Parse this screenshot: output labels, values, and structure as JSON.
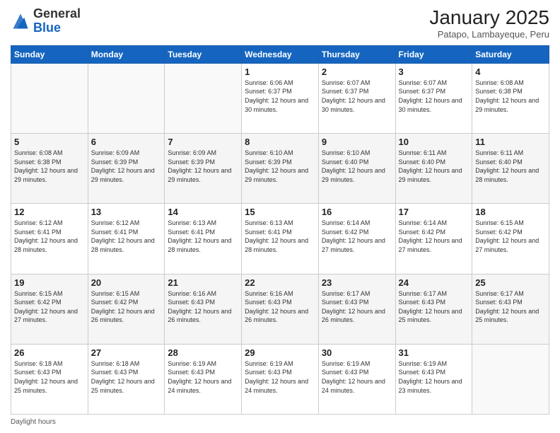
{
  "header": {
    "logo_general": "General",
    "logo_blue": "Blue",
    "month_year": "January 2025",
    "location": "Patapo, Lambayeque, Peru"
  },
  "days_of_week": [
    "Sunday",
    "Monday",
    "Tuesday",
    "Wednesday",
    "Thursday",
    "Friday",
    "Saturday"
  ],
  "footer": {
    "label": "Daylight hours"
  },
  "weeks": [
    [
      {
        "day": "",
        "sunrise": "",
        "sunset": "",
        "daylight": ""
      },
      {
        "day": "",
        "sunrise": "",
        "sunset": "",
        "daylight": ""
      },
      {
        "day": "",
        "sunrise": "",
        "sunset": "",
        "daylight": ""
      },
      {
        "day": "1",
        "sunrise": "Sunrise: 6:06 AM",
        "sunset": "Sunset: 6:37 PM",
        "daylight": "Daylight: 12 hours and 30 minutes."
      },
      {
        "day": "2",
        "sunrise": "Sunrise: 6:07 AM",
        "sunset": "Sunset: 6:37 PM",
        "daylight": "Daylight: 12 hours and 30 minutes."
      },
      {
        "day": "3",
        "sunrise": "Sunrise: 6:07 AM",
        "sunset": "Sunset: 6:37 PM",
        "daylight": "Daylight: 12 hours and 30 minutes."
      },
      {
        "day": "4",
        "sunrise": "Sunrise: 6:08 AM",
        "sunset": "Sunset: 6:38 PM",
        "daylight": "Daylight: 12 hours and 29 minutes."
      }
    ],
    [
      {
        "day": "5",
        "sunrise": "Sunrise: 6:08 AM",
        "sunset": "Sunset: 6:38 PM",
        "daylight": "Daylight: 12 hours and 29 minutes."
      },
      {
        "day": "6",
        "sunrise": "Sunrise: 6:09 AM",
        "sunset": "Sunset: 6:39 PM",
        "daylight": "Daylight: 12 hours and 29 minutes."
      },
      {
        "day": "7",
        "sunrise": "Sunrise: 6:09 AM",
        "sunset": "Sunset: 6:39 PM",
        "daylight": "Daylight: 12 hours and 29 minutes."
      },
      {
        "day": "8",
        "sunrise": "Sunrise: 6:10 AM",
        "sunset": "Sunset: 6:39 PM",
        "daylight": "Daylight: 12 hours and 29 minutes."
      },
      {
        "day": "9",
        "sunrise": "Sunrise: 6:10 AM",
        "sunset": "Sunset: 6:40 PM",
        "daylight": "Daylight: 12 hours and 29 minutes."
      },
      {
        "day": "10",
        "sunrise": "Sunrise: 6:11 AM",
        "sunset": "Sunset: 6:40 PM",
        "daylight": "Daylight: 12 hours and 29 minutes."
      },
      {
        "day": "11",
        "sunrise": "Sunrise: 6:11 AM",
        "sunset": "Sunset: 6:40 PM",
        "daylight": "Daylight: 12 hours and 28 minutes."
      }
    ],
    [
      {
        "day": "12",
        "sunrise": "Sunrise: 6:12 AM",
        "sunset": "Sunset: 6:41 PM",
        "daylight": "Daylight: 12 hours and 28 minutes."
      },
      {
        "day": "13",
        "sunrise": "Sunrise: 6:12 AM",
        "sunset": "Sunset: 6:41 PM",
        "daylight": "Daylight: 12 hours and 28 minutes."
      },
      {
        "day": "14",
        "sunrise": "Sunrise: 6:13 AM",
        "sunset": "Sunset: 6:41 PM",
        "daylight": "Daylight: 12 hours and 28 minutes."
      },
      {
        "day": "15",
        "sunrise": "Sunrise: 6:13 AM",
        "sunset": "Sunset: 6:41 PM",
        "daylight": "Daylight: 12 hours and 28 minutes."
      },
      {
        "day": "16",
        "sunrise": "Sunrise: 6:14 AM",
        "sunset": "Sunset: 6:42 PM",
        "daylight": "Daylight: 12 hours and 27 minutes."
      },
      {
        "day": "17",
        "sunrise": "Sunrise: 6:14 AM",
        "sunset": "Sunset: 6:42 PM",
        "daylight": "Daylight: 12 hours and 27 minutes."
      },
      {
        "day": "18",
        "sunrise": "Sunrise: 6:15 AM",
        "sunset": "Sunset: 6:42 PM",
        "daylight": "Daylight: 12 hours and 27 minutes."
      }
    ],
    [
      {
        "day": "19",
        "sunrise": "Sunrise: 6:15 AM",
        "sunset": "Sunset: 6:42 PM",
        "daylight": "Daylight: 12 hours and 27 minutes."
      },
      {
        "day": "20",
        "sunrise": "Sunrise: 6:15 AM",
        "sunset": "Sunset: 6:42 PM",
        "daylight": "Daylight: 12 hours and 26 minutes."
      },
      {
        "day": "21",
        "sunrise": "Sunrise: 6:16 AM",
        "sunset": "Sunset: 6:43 PM",
        "daylight": "Daylight: 12 hours and 26 minutes."
      },
      {
        "day": "22",
        "sunrise": "Sunrise: 6:16 AM",
        "sunset": "Sunset: 6:43 PM",
        "daylight": "Daylight: 12 hours and 26 minutes."
      },
      {
        "day": "23",
        "sunrise": "Sunrise: 6:17 AM",
        "sunset": "Sunset: 6:43 PM",
        "daylight": "Daylight: 12 hours and 26 minutes."
      },
      {
        "day": "24",
        "sunrise": "Sunrise: 6:17 AM",
        "sunset": "Sunset: 6:43 PM",
        "daylight": "Daylight: 12 hours and 25 minutes."
      },
      {
        "day": "25",
        "sunrise": "Sunrise: 6:17 AM",
        "sunset": "Sunset: 6:43 PM",
        "daylight": "Daylight: 12 hours and 25 minutes."
      }
    ],
    [
      {
        "day": "26",
        "sunrise": "Sunrise: 6:18 AM",
        "sunset": "Sunset: 6:43 PM",
        "daylight": "Daylight: 12 hours and 25 minutes."
      },
      {
        "day": "27",
        "sunrise": "Sunrise: 6:18 AM",
        "sunset": "Sunset: 6:43 PM",
        "daylight": "Daylight: 12 hours and 25 minutes."
      },
      {
        "day": "28",
        "sunrise": "Sunrise: 6:19 AM",
        "sunset": "Sunset: 6:43 PM",
        "daylight": "Daylight: 12 hours and 24 minutes."
      },
      {
        "day": "29",
        "sunrise": "Sunrise: 6:19 AM",
        "sunset": "Sunset: 6:43 PM",
        "daylight": "Daylight: 12 hours and 24 minutes."
      },
      {
        "day": "30",
        "sunrise": "Sunrise: 6:19 AM",
        "sunset": "Sunset: 6:43 PM",
        "daylight": "Daylight: 12 hours and 24 minutes."
      },
      {
        "day": "31",
        "sunrise": "Sunrise: 6:19 AM",
        "sunset": "Sunset: 6:43 PM",
        "daylight": "Daylight: 12 hours and 23 minutes."
      },
      {
        "day": "",
        "sunrise": "",
        "sunset": "",
        "daylight": ""
      }
    ]
  ]
}
